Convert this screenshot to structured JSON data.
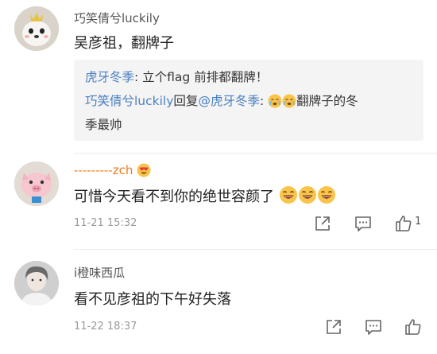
{
  "comments": [
    {
      "username": "巧笑倩兮luckily",
      "text": "吴彦祖，翻牌子",
      "reply": {
        "line1_user": "虎牙冬季",
        "line1_text": ": 立个flag 前排都翻牌！",
        "line2_user": "巧笑倩兮luckily",
        "line2_mid": "回复",
        "line2_mention": "@虎牙冬季",
        "line2_colon": ":",
        "line2_text": "翻牌子的冬",
        "line3_text": "季最帅"
      }
    },
    {
      "username": "---------zch",
      "text": "可惜今天看不到你的绝世容颜了",
      "time": "11-21 15:32",
      "likes": "1"
    },
    {
      "username": "i橙味西瓜",
      "text": "看不见彦祖的下午好失落",
      "time": "11-22 18:37"
    }
  ],
  "colors": {
    "link": "#4a7fc1",
    "username_orange": "#f07b1e",
    "reply_bg": "#f4f4f4"
  }
}
